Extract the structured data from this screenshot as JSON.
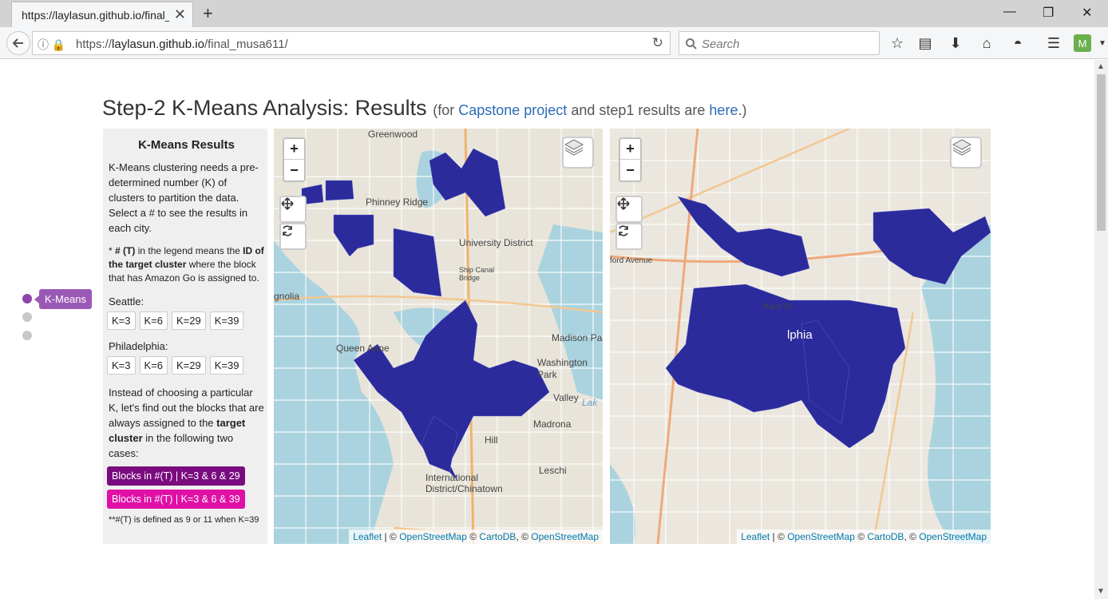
{
  "browser": {
    "tab_title": "https://laylasun.github.io/final_m",
    "url_prefix": "https://",
    "url_host": "laylasun.github.io",
    "url_path": "/final_musa611/",
    "search_placeholder": "Search"
  },
  "page": {
    "title": "Step-2 K-Means Analysis: Results",
    "sub_prefix": "(for ",
    "link_capstone": "Capstone project",
    "sub_middle": " and step1 results are ",
    "link_here": "here",
    "sub_suffix": ".)"
  },
  "slide_nav": {
    "active_label": "K-Means"
  },
  "sidebar": {
    "title": "K-Means Results",
    "intro": "K-Means clustering needs a pre-determined number (K) of clusters to partition the data. Select a # to see the results in each city.",
    "note_1": "* ",
    "note_bold_1": "# (T)",
    "note_2": " in the legend means the ",
    "note_bold_2": "ID of the target cluster",
    "note_3": " where the block that has Amazon Go is assigned to.",
    "seattle_label": "Seattle:",
    "philly_label": "Philadelphia:",
    "k_buttons": [
      "K=3",
      "K=6",
      "K=29",
      "K=39"
    ],
    "para2_a": "Instead of choosing a particular K, let's find out the blocks that are always assigned to the ",
    "para2_bold1": "target cluster",
    "para2_b": " in the following two cases:",
    "blocks_btn_1": "Blocks in #(T) | K=3 & 6 & 29",
    "blocks_btn_2": "Blocks in #(T) | K=3 & 6 & 39",
    "footnote": "**#(T) is defined as 9 or 11 when K=39"
  },
  "map_controls": {
    "zoom_in": "+",
    "zoom_out": "−"
  },
  "attribution": {
    "leaflet": "Leaflet",
    "sep1": " | © ",
    "osm1": "OpenStreetMap",
    "sep2": " © ",
    "carto": "CartoDB",
    "sep3": ", © ",
    "osm2": "OpenStreetMap"
  },
  "seattle_map_labels": [
    "Greenwood",
    "Phinney Ridge",
    "University District",
    "Ship Canal Bridge",
    "Madison Pa",
    "Washington Park",
    "Valley",
    "Madrona",
    "Hill",
    "Inter­national District/Chinatown",
    "Leschi",
    "Queen Anne",
    "gnolia",
    "Lak"
  ],
  "philly_map_labels": [
    "ford Avenue",
    "Race St",
    "lphia"
  ],
  "colors": {
    "cluster_fill": "#2b2b9c",
    "active_dot": "#8e44ad",
    "btn_dark_magenta": "#7a0b7f",
    "btn_magenta": "#e010a6",
    "link": "#2a6cb6"
  }
}
